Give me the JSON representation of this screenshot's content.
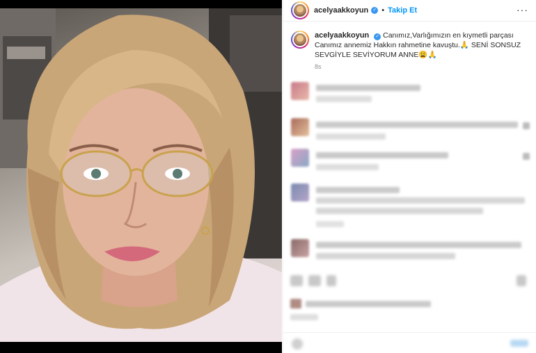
{
  "post": {
    "username": "acelyaakkoyun",
    "verified_icon": "verified-badge-icon",
    "separator": "•",
    "follow_label": "Takip Et",
    "more_label": "···",
    "caption": {
      "username": "acelyaakkoyun",
      "text": "Canımız,Varlığımızın en kıymetli parçası Canımız annemiz Hakkın rahmetine kavuştu.🙏 SENİ SONSUZ SEVGİYLE SEVİYORUM ANNE😩🙏",
      "time": "8s"
    }
  },
  "colors": {
    "accent": "#0095f6",
    "verified": "#3897f0",
    "text": "#262626",
    "muted": "#8e8e8e"
  }
}
